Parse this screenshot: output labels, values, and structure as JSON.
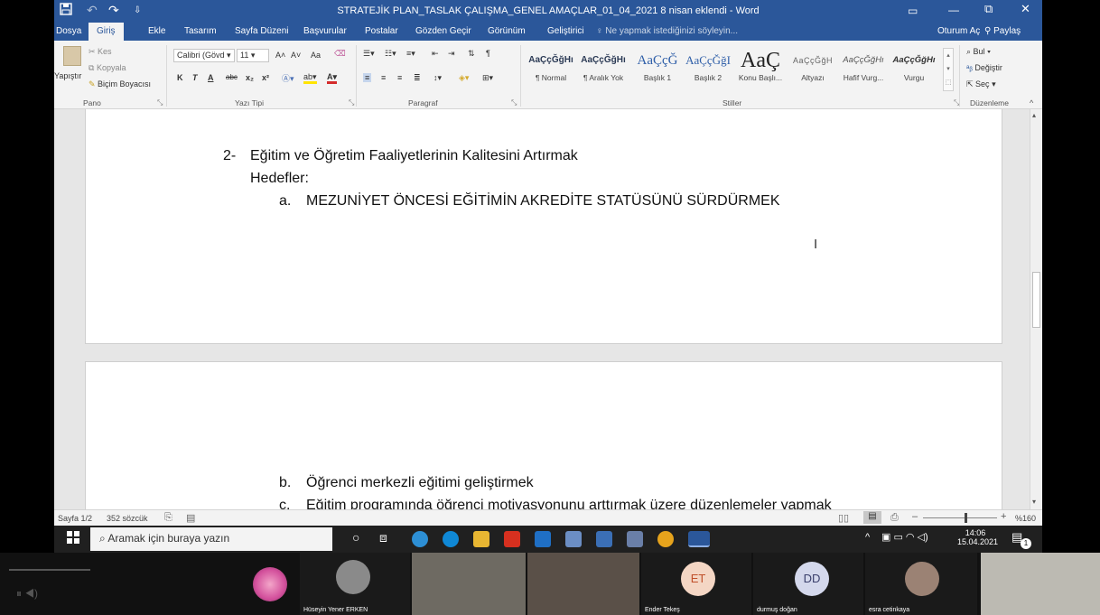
{
  "window": {
    "title": "STRATEJİK PLAN_TASLAK ÇALIŞMA_GENEL AMAÇLAR_01_04_2021 8 nisan eklendi - Word",
    "restore_label": "▭",
    "minimize_label": "—",
    "maximize_label": "⧉",
    "close_label": "✕"
  },
  "quick_access": {
    "save_icon": "save-icon",
    "undo_icon": "undo-icon",
    "redo_icon": "redo-icon"
  },
  "tabs": [
    {
      "label": "Dosya"
    },
    {
      "label": "Giriş"
    },
    {
      "label": "Ekle"
    },
    {
      "label": "Tasarım"
    },
    {
      "label": "Sayfa Düzeni"
    },
    {
      "label": "Başvurular"
    },
    {
      "label": "Postalar"
    },
    {
      "label": "Gözden Geçir"
    },
    {
      "label": "Görünüm"
    },
    {
      "label": "Geliştirici"
    }
  ],
  "tell_me": "Ne yapmak istediğinizi söyleyin...",
  "account": {
    "signin": "Oturum Aç",
    "share": "Paylaş"
  },
  "ribbon": {
    "clipboard": {
      "paste": "Yapıştır",
      "cut": "Kes",
      "copy": "Kopyala",
      "format_painter": "Biçim Boyacısı",
      "group": "Pano"
    },
    "font": {
      "name": "Calibri (Gövd",
      "size": "11",
      "grow": "A˄",
      "shrink": "A˅",
      "case": "Aa",
      "bold": "K",
      "italic": "T",
      "underline": "A",
      "strike": "abc",
      "subscript": "x₂",
      "superscript": "x²",
      "group": "Yazı Tipi"
    },
    "paragraph": {
      "group": "Paragraf"
    },
    "styles": {
      "group": "Stiller",
      "items": [
        {
          "sample": "AaÇçĞğHı",
          "name": "¶ Normal"
        },
        {
          "sample": "AaÇçĞğHı",
          "name": "¶ Aralık Yok"
        },
        {
          "sample": "AaÇçĞ",
          "name": "Başlık 1"
        },
        {
          "sample": "AaÇçĞğI",
          "name": "Başlık 2"
        },
        {
          "sample": "AaÇ",
          "name": "Konu Başlı..."
        },
        {
          "sample": "AaÇçĞğH",
          "name": "Altyazı"
        },
        {
          "sample": "AaÇçĞğHı",
          "name": "Hafif Vurg..."
        },
        {
          "sample": "AaÇçĞğHı",
          "name": "Vurgu"
        }
      ]
    },
    "editing": {
      "find": "Bul",
      "replace": "Değiştir",
      "select": "Seç",
      "group": "Düzenleme"
    }
  },
  "document": {
    "page1": {
      "item2_num": "2-",
      "item2_text": "Eğitim ve Öğretim Faaliyetlerinin Kalitesini Artırmak",
      "hedefler": "Hedefler:",
      "a_num": "a.",
      "a_text": "MEZUNİYET ÖNCESİ EĞİTİMİN AKREDİTE STATÜSÜNÜ SÜRDÜRMEK"
    },
    "page2": {
      "b_num": "b.",
      "b_text": "Öğrenci merkezli eğitimi geliştirmek",
      "c_num": "c.",
      "c_text": "Eğitim programında öğrenci motivasyonunu arttırmak üzere düzenlemeler yapmak"
    }
  },
  "status": {
    "page": "Sayfa 1/2",
    "words": "352 sözcük",
    "zoom": "%160"
  },
  "taskbar": {
    "search_placeholder": "Aramak için buraya yazın",
    "time": "14:06",
    "date": "15.04.2021",
    "notifications": "1"
  },
  "participants": [
    {
      "name": "Hüseyin Yener ERKEN"
    },
    {
      "name": "Ender Tekeş",
      "initials": "ET"
    },
    {
      "name": "durmuş doğan",
      "initials": "DD"
    },
    {
      "name": "esra cetinkaya"
    }
  ],
  "colors": {
    "word_blue": "#2b579a",
    "taskbar": "#202020",
    "ruler_bg": "#e6e6e6"
  }
}
